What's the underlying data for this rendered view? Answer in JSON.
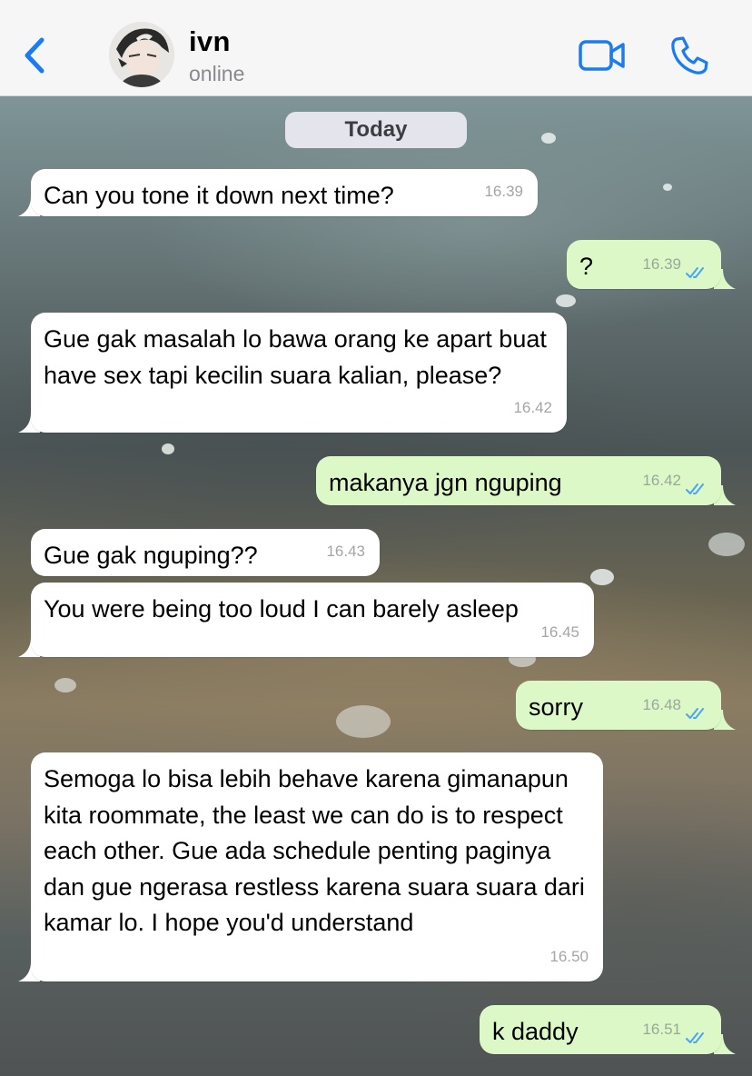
{
  "header": {
    "contact_name": "ivn",
    "status": "online"
  },
  "icons": {
    "back": "chevron-left-icon",
    "video": "video-camera-icon",
    "phone": "phone-icon"
  },
  "colors": {
    "accent": "#1a7cf0",
    "incoming_bubble": "#ffffff",
    "outgoing_bubble": "#dcf8c6",
    "read_ticks": "#4aa4f5"
  },
  "chat": {
    "date_label": "Today",
    "messages": [
      {
        "direction": "in",
        "text": "Can you tone it down next time?",
        "time": "16.39"
      },
      {
        "direction": "out",
        "text": "?",
        "time": "16.39",
        "read": true
      },
      {
        "direction": "in",
        "text": "Gue gak masalah lo bawa orang ke apart buat have sex tapi kecilin suara kalian, please?",
        "time": "16.42"
      },
      {
        "direction": "out",
        "text": "makanya jgn nguping",
        "time": "16.42",
        "read": true
      },
      {
        "direction": "in",
        "text": "Gue gak nguping??",
        "time": "16.43"
      },
      {
        "direction": "in",
        "text": "You were being too loud I can barely asleep",
        "time": "16.45"
      },
      {
        "direction": "out",
        "text": "sorry",
        "time": "16.48",
        "read": true
      },
      {
        "direction": "in",
        "text": "Semoga lo bisa lebih behave karena gimanapun kita roommate, the least we can do is to respect each other. Gue ada schedule penting paginya dan gue ngerasa restless karena suara suara dari kamar lo. I hope you'd understand",
        "time": "16.50"
      },
      {
        "direction": "out",
        "text": "k daddy",
        "time": "16.51",
        "read": true
      }
    ]
  }
}
